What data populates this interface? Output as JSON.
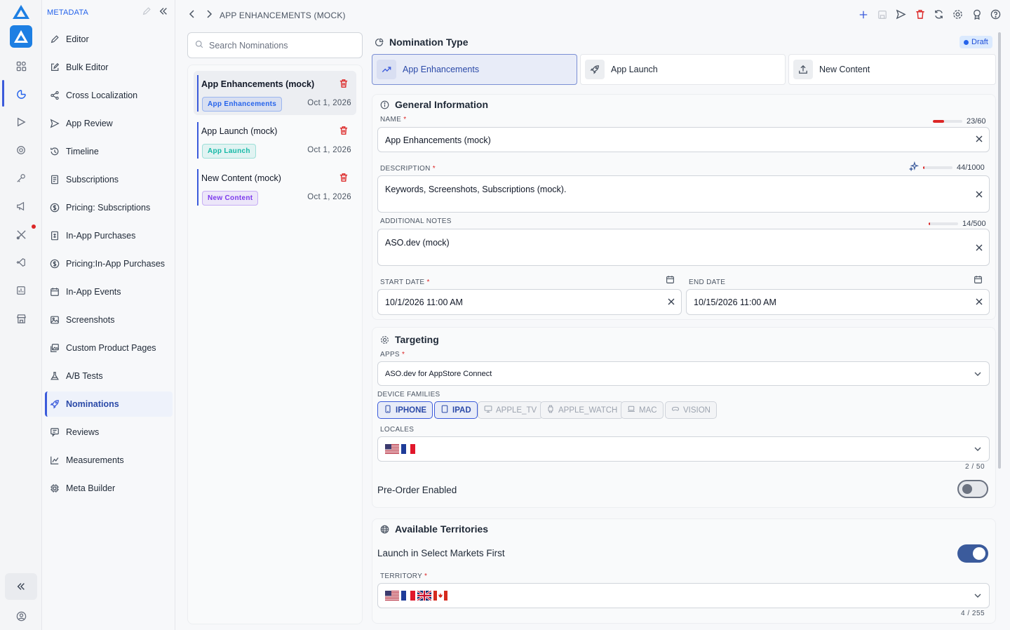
{
  "sidebar": {
    "section_title": "METADATA",
    "items": [
      {
        "label": "Editor",
        "icon": "pencil-icon"
      },
      {
        "label": "Bulk Editor",
        "icon": "edit-square-icon"
      },
      {
        "label": "Cross Localization",
        "icon": "share-nodes-icon"
      },
      {
        "label": "App Review",
        "icon": "send-icon"
      },
      {
        "label": "Timeline",
        "icon": "history-icon"
      },
      {
        "label": "Subscriptions",
        "icon": "receipt-icon"
      },
      {
        "label": "Pricing: Subscriptions",
        "icon": "dollar-circle-icon"
      },
      {
        "label": "In-App Purchases",
        "icon": "purchase-doc-icon"
      },
      {
        "label": "Pricing:In-App Purchases",
        "icon": "dollar-circle-icon"
      },
      {
        "label": "In-App Events",
        "icon": "calendar-icon"
      },
      {
        "label": "Screenshots",
        "icon": "image-icon"
      },
      {
        "label": "Custom Product Pages",
        "icon": "images-icon"
      },
      {
        "label": "A/B Tests",
        "icon": "flask-icon"
      },
      {
        "label": "Nominations",
        "icon": "rocket-icon"
      },
      {
        "label": "Reviews",
        "icon": "review-icon"
      },
      {
        "label": "Measurements",
        "icon": "chart-icon"
      },
      {
        "label": "Meta Builder",
        "icon": "chip-icon"
      }
    ],
    "active": "Nominations"
  },
  "topbar": {
    "breadcrumb": "APP ENHANCEMENTS (MOCK)"
  },
  "search": {
    "placeholder": "Search Nominations"
  },
  "nominations": [
    {
      "title": "App Enhancements (mock)",
      "badge": "App Enhancements",
      "date": "Oct 1, 2026",
      "badge_color": "#2563eb"
    },
    {
      "title": "App Launch (mock)",
      "badge": "App Launch",
      "date": "Oct 1, 2026",
      "badge_color": "#14b8a6"
    },
    {
      "title": "New Content (mock)",
      "badge": "New Content",
      "date": "Oct 1, 2026",
      "badge_color": "#7c3aed"
    }
  ],
  "main": {
    "nomination_type_title": "Nomination Type",
    "status_badge": "Draft",
    "types": [
      "App Enhancements",
      "App Launch",
      "New Content"
    ],
    "general": {
      "title": "General Information",
      "name_label": "NAME",
      "name_value": "App Enhancements (mock)",
      "name_count": "23/60",
      "name_fill": 0.38,
      "description_label": "DESCRIPTION",
      "description_value": "Keywords, Screenshots, Subscriptions (mock).",
      "description_count": "44/1000",
      "description_fill": 0.044,
      "notes_label": "ADDITIONAL NOTES",
      "notes_value": "ASO.dev (mock)",
      "notes_count": "14/500",
      "notes_fill": 0.028,
      "start_label": "START DATE",
      "start_value": "10/1/2026 11:00 AM",
      "end_label": "END DATE",
      "end_value": "10/15/2026 11:00 AM"
    },
    "targeting": {
      "title": "Targeting",
      "apps_label": "APPS",
      "apps_value": "ASO.dev for AppStore Connect",
      "devices_label": "DEVICE FAMILIES",
      "devices": [
        {
          "label": "IPHONE",
          "selected": true
        },
        {
          "label": "IPAD",
          "selected": true
        },
        {
          "label": "APPLE_TV",
          "selected": false
        },
        {
          "label": "APPLE_WATCH",
          "selected": false
        },
        {
          "label": "MAC",
          "selected": false
        },
        {
          "label": "VISION",
          "selected": false
        }
      ],
      "locales_label": "LOCALES",
      "locales_count": "2 / 50",
      "preorder_label": "Pre-Order Enabled",
      "preorder_on": false
    },
    "territories": {
      "title": "Available Territories",
      "launch_label": "Launch in Select Markets First",
      "launch_on": true,
      "territory_label": "TERRITORY",
      "territory_count": "4 / 255"
    }
  }
}
